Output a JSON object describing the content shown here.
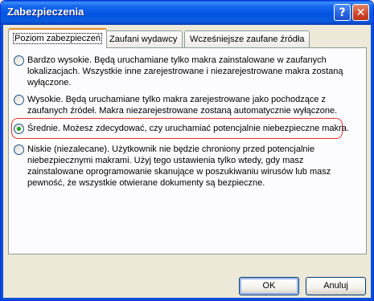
{
  "window": {
    "title": "Zabezpieczenia",
    "help_glyph": "?",
    "close_glyph": "✕"
  },
  "tabs": [
    {
      "label": "Poziom zabezpieczeń",
      "mnemonic_index": 0,
      "active": true
    },
    {
      "label": "Zaufani wydawcy",
      "active": false
    },
    {
      "label": "Wcześniejsze zaufane źródła",
      "active": false
    }
  ],
  "options": [
    {
      "label": "Bardzo wysokie. Będą uruchamiane tylko makra zainstalowane w zaufanych lokalizacjach. Wszystkie inne zarejestrowane i niezarejestrowane makra zostaną wyłączone.",
      "checked": false
    },
    {
      "label": "Wysokie. Będą uruchamiane tylko makra zarejestrowane jako pochodzące z zaufanych źródeł. Makra niezarejestrowane zostaną automatycznie wyłączone.",
      "checked": false
    },
    {
      "label": "Średnie. Możesz zdecydować, czy uruchamiać potencjalnie niebezpieczne makra.",
      "checked": true
    },
    {
      "label": "Niskie (niezalecane). Użytkownik nie będzie chroniony przed potencjalnie niebezpiecznymi makrami. Użyj tego ustawienia tylko wtedy, gdy masz zainstalowane oprogramowanie skanujące w poszukiwaniu wirusów lub masz pewność, że wszystkie otwierane dokumenty są bezpieczne.",
      "checked": false
    }
  ],
  "buttons": {
    "ok": "OK",
    "cancel": "Anuluj"
  },
  "colors": {
    "titlebar": "#0255e3",
    "dialog_bg": "#ece9d8",
    "highlight_border": "#e0332f",
    "radio_dot": "#21a121"
  }
}
